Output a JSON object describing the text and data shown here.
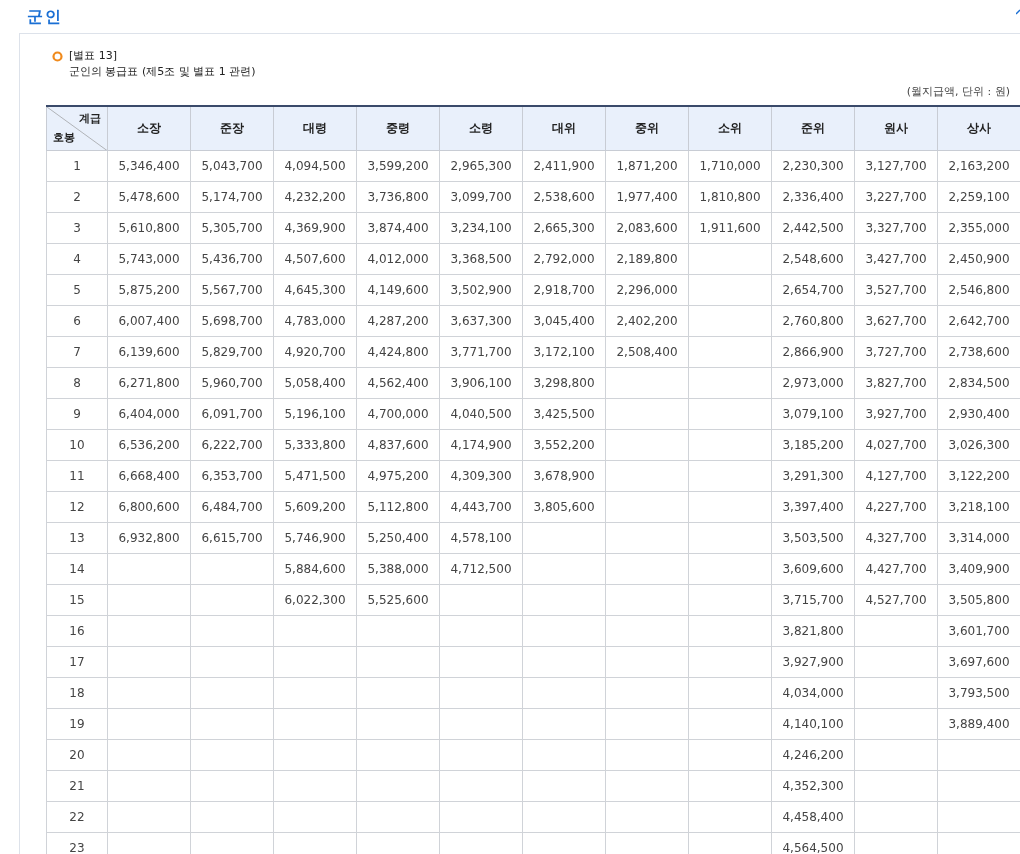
{
  "heading": "군인",
  "table_ref": "[별표 13]",
  "table_title": "군인의 봉급표 (제5조 및 별표 1 관련)",
  "unit_note": "(월지급액, 단위 : 원)",
  "corner": {
    "top": "계급",
    "bottom": "호봉"
  },
  "columns": [
    "소장",
    "준장",
    "대령",
    "중령",
    "소령",
    "대위",
    "중위",
    "소위",
    "준위",
    "원사",
    "상사"
  ],
  "rows": [
    {
      "step": "1",
      "cells": [
        "5,346,400",
        "5,043,700",
        "4,094,500",
        "3,599,200",
        "2,965,300",
        "2,411,900",
        "1,871,200",
        "1,710,000",
        "2,230,300",
        "3,127,700",
        "2,163,200"
      ]
    },
    {
      "step": "2",
      "cells": [
        "5,478,600",
        "5,174,700",
        "4,232,200",
        "3,736,800",
        "3,099,700",
        "2,538,600",
        "1,977,400",
        "1,810,800",
        "2,336,400",
        "3,227,700",
        "2,259,100"
      ]
    },
    {
      "step": "3",
      "cells": [
        "5,610,800",
        "5,305,700",
        "4,369,900",
        "3,874,400",
        "3,234,100",
        "2,665,300",
        "2,083,600",
        "1,911,600",
        "2,442,500",
        "3,327,700",
        "2,355,000"
      ]
    },
    {
      "step": "4",
      "cells": [
        "5,743,000",
        "5,436,700",
        "4,507,600",
        "4,012,000",
        "3,368,500",
        "2,792,000",
        "2,189,800",
        null,
        "2,548,600",
        "3,427,700",
        "2,450,900"
      ]
    },
    {
      "step": "5",
      "cells": [
        "5,875,200",
        "5,567,700",
        "4,645,300",
        "4,149,600",
        "3,502,900",
        "2,918,700",
        "2,296,000",
        null,
        "2,654,700",
        "3,527,700",
        "2,546,800"
      ]
    },
    {
      "step": "6",
      "cells": [
        "6,007,400",
        "5,698,700",
        "4,783,000",
        "4,287,200",
        "3,637,300",
        "3,045,400",
        "2,402,200",
        null,
        "2,760,800",
        "3,627,700",
        "2,642,700"
      ]
    },
    {
      "step": "7",
      "cells": [
        "6,139,600",
        "5,829,700",
        "4,920,700",
        "4,424,800",
        "3,771,700",
        "3,172,100",
        "2,508,400",
        null,
        "2,866,900",
        "3,727,700",
        "2,738,600"
      ]
    },
    {
      "step": "8",
      "cells": [
        "6,271,800",
        "5,960,700",
        "5,058,400",
        "4,562,400",
        "3,906,100",
        "3,298,800",
        null,
        null,
        "2,973,000",
        "3,827,700",
        "2,834,500"
      ]
    },
    {
      "step": "9",
      "cells": [
        "6,404,000",
        "6,091,700",
        "5,196,100",
        "4,700,000",
        "4,040,500",
        "3,425,500",
        null,
        null,
        "3,079,100",
        "3,927,700",
        "2,930,400"
      ]
    },
    {
      "step": "10",
      "cells": [
        "6,536,200",
        "6,222,700",
        "5,333,800",
        "4,837,600",
        "4,174,900",
        "3,552,200",
        null,
        null,
        "3,185,200",
        "4,027,700",
        "3,026,300"
      ]
    },
    {
      "step": "11",
      "cells": [
        "6,668,400",
        "6,353,700",
        "5,471,500",
        "4,975,200",
        "4,309,300",
        "3,678,900",
        null,
        null,
        "3,291,300",
        "4,127,700",
        "3,122,200"
      ]
    },
    {
      "step": "12",
      "cells": [
        "6,800,600",
        "6,484,700",
        "5,609,200",
        "5,112,800",
        "4,443,700",
        "3,805,600",
        null,
        null,
        "3,397,400",
        "4,227,700",
        "3,218,100"
      ]
    },
    {
      "step": "13",
      "cells": [
        "6,932,800",
        "6,615,700",
        "5,746,900",
        "5,250,400",
        "4,578,100",
        null,
        null,
        null,
        "3,503,500",
        "4,327,700",
        "3,314,000"
      ]
    },
    {
      "step": "14",
      "cells": [
        null,
        null,
        "5,884,600",
        "5,388,000",
        "4,712,500",
        null,
        null,
        null,
        "3,609,600",
        "4,427,700",
        "3,409,900"
      ]
    },
    {
      "step": "15",
      "cells": [
        null,
        null,
        "6,022,300",
        "5,525,600",
        null,
        null,
        null,
        null,
        "3,715,700",
        "4,527,700",
        "3,505,800"
      ]
    },
    {
      "step": "16",
      "cells": [
        null,
        null,
        null,
        null,
        null,
        null,
        null,
        null,
        "3,821,800",
        null,
        "3,601,700"
      ]
    },
    {
      "step": "17",
      "cells": [
        null,
        null,
        null,
        null,
        null,
        null,
        null,
        null,
        "3,927,900",
        null,
        "3,697,600"
      ]
    },
    {
      "step": "18",
      "cells": [
        null,
        null,
        null,
        null,
        null,
        null,
        null,
        null,
        "4,034,000",
        null,
        "3,793,500"
      ]
    },
    {
      "step": "19",
      "cells": [
        null,
        null,
        null,
        null,
        null,
        null,
        null,
        null,
        "4,140,100",
        null,
        "3,889,400"
      ]
    },
    {
      "step": "20",
      "cells": [
        null,
        null,
        null,
        null,
        null,
        null,
        null,
        null,
        "4,246,200",
        null,
        null
      ]
    },
    {
      "step": "21",
      "cells": [
        null,
        null,
        null,
        null,
        null,
        null,
        null,
        null,
        "4,352,300",
        null,
        null
      ]
    },
    {
      "step": "22",
      "cells": [
        null,
        null,
        null,
        null,
        null,
        null,
        null,
        null,
        "4,458,400",
        null,
        null
      ]
    },
    {
      "step": "23",
      "cells": [
        null,
        null,
        null,
        null,
        null,
        null,
        null,
        null,
        "4,564,500",
        null,
        null
      ]
    }
  ]
}
